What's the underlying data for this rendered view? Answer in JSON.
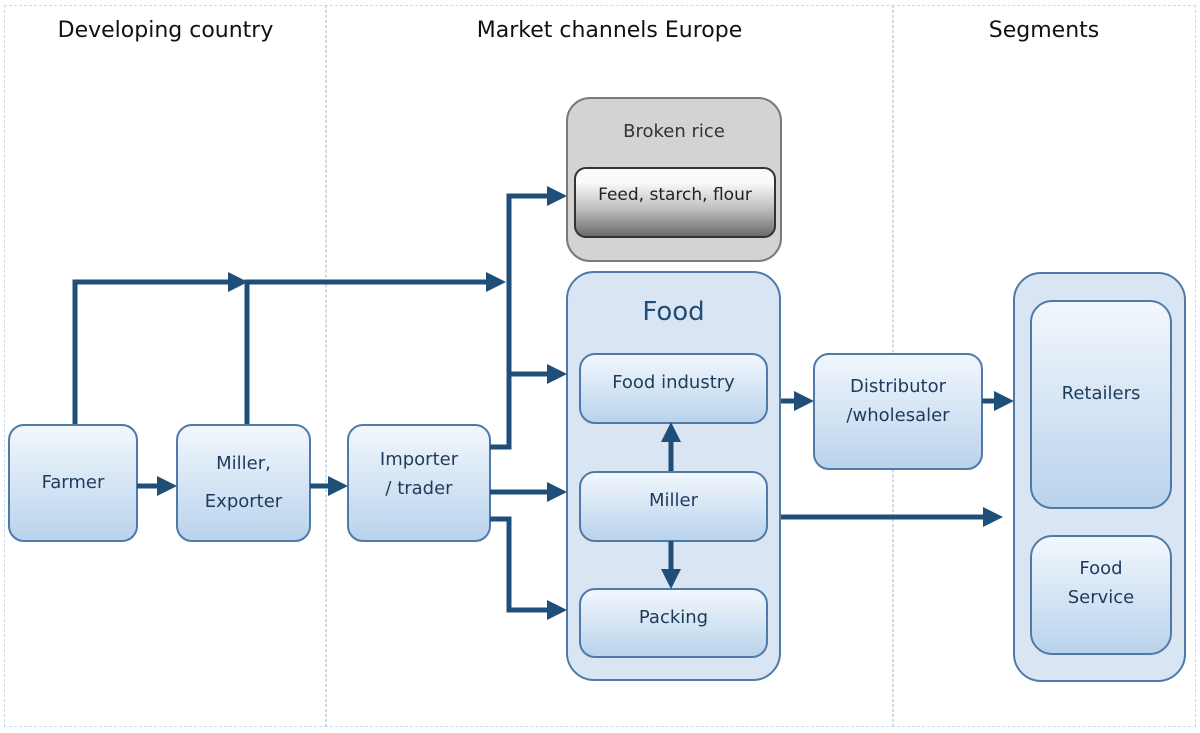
{
  "columns": [
    {
      "title": "Developing country"
    },
    {
      "title": "Market channels Europe"
    },
    {
      "title": "Segments"
    }
  ],
  "nodes": {
    "farmer": "Farmer",
    "miller_exporter_line1": "Miller,",
    "miller_exporter_line2": "Exporter",
    "importer_line1": "Importer",
    "importer_line2": "/ trader",
    "broken_rice": "Broken rice",
    "feed": "Feed, starch, flour",
    "food": "Food",
    "food_industry": "Food industry",
    "miller": "Miller",
    "packing": "Packing",
    "distributor_line1": "Distributor",
    "distributor_line2": "/wholesaler",
    "retailers": "Retailers",
    "food_service_line1": "Food",
    "food_service_line2": "Service"
  },
  "colors": {
    "arrow": "#1f4e79",
    "box_border": "#4f7aa8",
    "box_fill": "#dae5f3",
    "gray_fill": "#d4d2d2"
  }
}
